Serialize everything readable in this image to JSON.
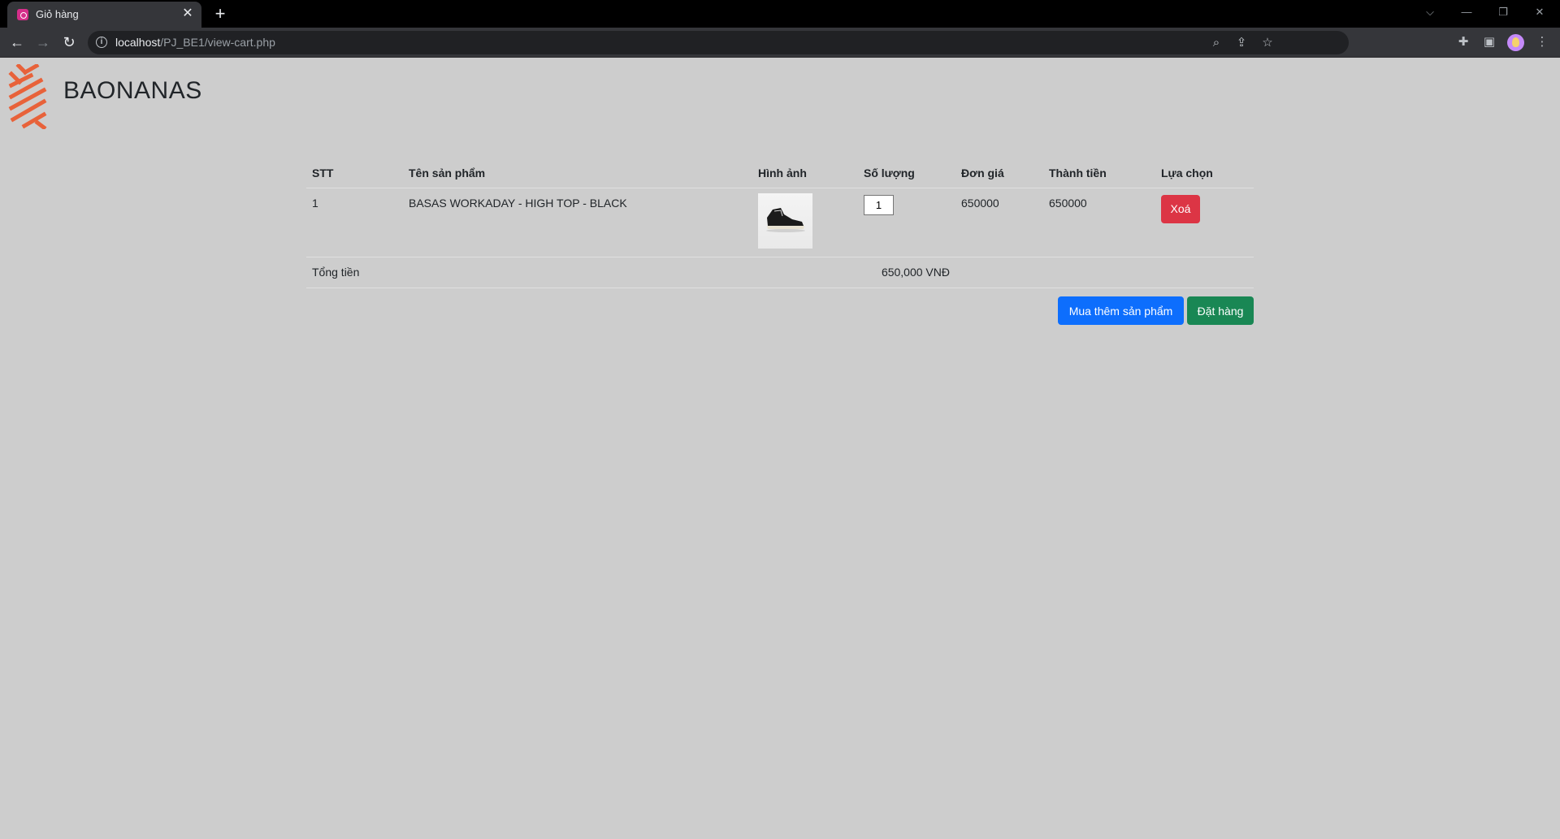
{
  "browser": {
    "tab_title": "Giỏ hàng",
    "tab_close": "✕",
    "new_tab": "+",
    "url_host": "localhost",
    "url_path": "/PJ_BE1/view-cart.php"
  },
  "header": {
    "brand": "BAONANAS",
    "logo_color": "#e8623a"
  },
  "cart": {
    "columns": [
      "STT",
      "Tên sản phẩm",
      "Hình ảnh",
      "Số lượng",
      "Đơn giá",
      "Thành tiền",
      "Lựa chọn"
    ],
    "rows": [
      {
        "stt": "1",
        "name": "BASAS WORKADAY - HIGH TOP - BLACK",
        "quantity": "1",
        "unit_price": "650000",
        "line_total": "650000",
        "delete_label": "Xoá"
      }
    ],
    "total_label": "Tổng tiền",
    "total_value": "650,000 VNĐ"
  },
  "actions": {
    "continue_label": "Mua thêm sản phẩm",
    "order_label": "Đặt hàng"
  },
  "colors": {
    "background": "#cdcdcd",
    "primary": "#0d6efd",
    "success": "#198754",
    "danger": "#dc3545"
  }
}
